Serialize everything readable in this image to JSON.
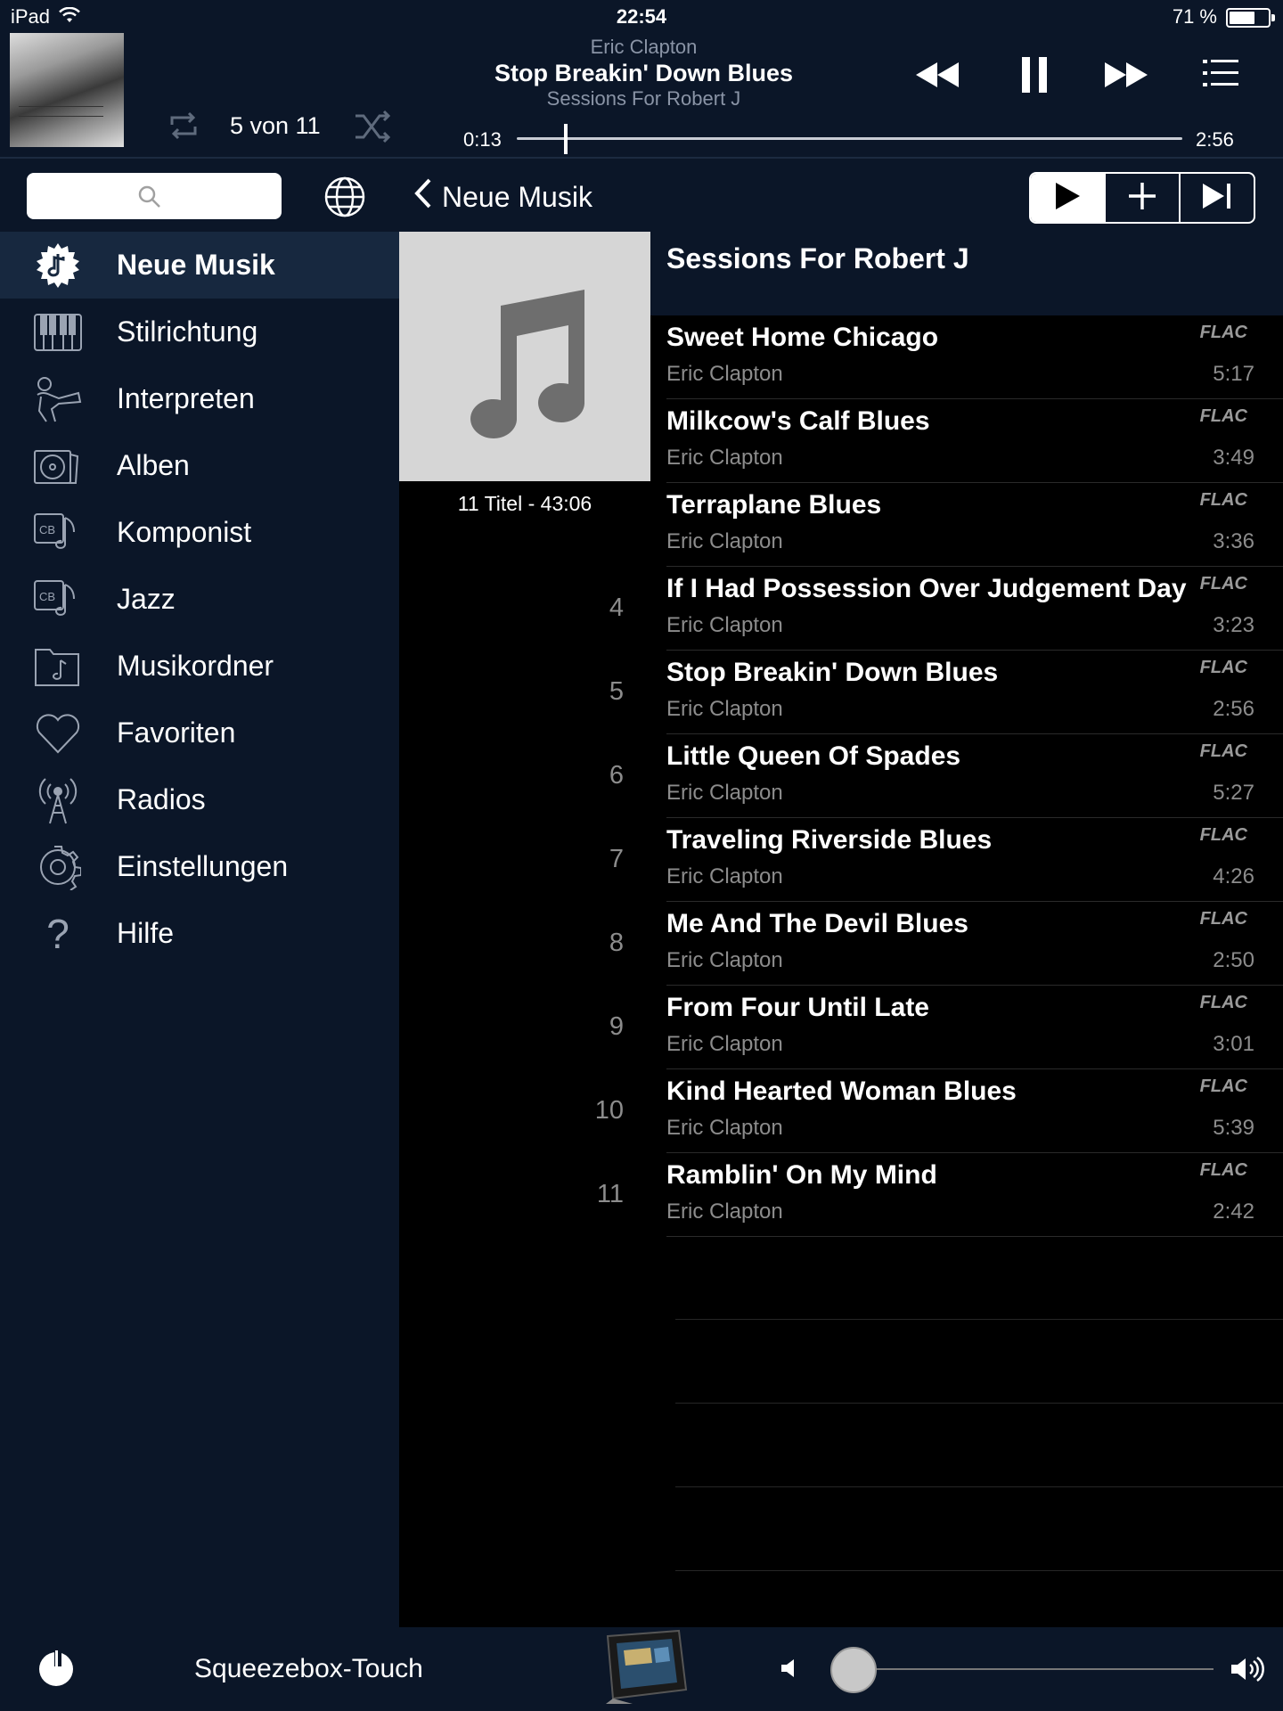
{
  "status_bar": {
    "device": "iPad",
    "time": "22:54",
    "battery": "71 %",
    "battery_level": 0.71
  },
  "now_playing": {
    "artist": "Eric Clapton",
    "title": "Stop Breakin' Down Blues",
    "album": "Sessions For Robert J",
    "position": "5 von 11",
    "elapsed": "0:13",
    "duration": "2:56",
    "progress": 0.074,
    "icons": [
      "repeat-icon",
      "shuffle-icon",
      "rewind-icon",
      "pause-icon",
      "fast-forward-icon",
      "queue-list-icon"
    ]
  },
  "nav": {
    "back_label": "Neue Musik",
    "actions": [
      "play-icon",
      "add-icon",
      "play-next-icon"
    ]
  },
  "sidebar": {
    "items": [
      {
        "label": "Neue Musik",
        "icon": "new-music-icon",
        "active": true
      },
      {
        "label": "Stilrichtung",
        "icon": "piano-icon"
      },
      {
        "label": "Interpreten",
        "icon": "musician-icon"
      },
      {
        "label": "Alben",
        "icon": "albums-icon"
      },
      {
        "label": "Komponist",
        "icon": "composer-icon"
      },
      {
        "label": "Jazz",
        "icon": "jazz-icon"
      },
      {
        "label": "Musikordner",
        "icon": "music-folder-icon"
      },
      {
        "label": "Favoriten",
        "icon": "heart-icon"
      },
      {
        "label": "Radios",
        "icon": "radio-icon"
      },
      {
        "label": "Einstellungen",
        "icon": "gear-icon"
      },
      {
        "label": "Hilfe",
        "icon": "help-icon"
      }
    ]
  },
  "album": {
    "title": "Sessions For Robert J",
    "summary": "11 Titel - 43:06",
    "tracks": [
      {
        "num": "",
        "title": "Sweet Home Chicago",
        "artist": "Eric Clapton",
        "format": "FLAC",
        "duration": "5:17"
      },
      {
        "num": "",
        "title": "Milkcow's Calf Blues",
        "artist": "Eric Clapton",
        "format": "FLAC",
        "duration": "3:49"
      },
      {
        "num": "",
        "title": "Terraplane Blues",
        "artist": "Eric Clapton",
        "format": "FLAC",
        "duration": "3:36"
      },
      {
        "num": "4",
        "title": "If I Had Possession Over Judgement Day",
        "artist": "Eric Clapton",
        "format": "FLAC",
        "duration": "3:23"
      },
      {
        "num": "5",
        "title": "Stop Breakin' Down Blues",
        "artist": "Eric Clapton",
        "format": "FLAC",
        "duration": "2:56"
      },
      {
        "num": "6",
        "title": "Little Queen Of Spades",
        "artist": "Eric Clapton",
        "format": "FLAC",
        "duration": "5:27"
      },
      {
        "num": "7",
        "title": "Traveling Riverside Blues",
        "artist": "Eric Clapton",
        "format": "FLAC",
        "duration": "4:26"
      },
      {
        "num": "8",
        "title": "Me And The Devil Blues",
        "artist": "Eric Clapton",
        "format": "FLAC",
        "duration": "2:50"
      },
      {
        "num": "9",
        "title": "From Four Until Late",
        "artist": "Eric Clapton",
        "format": "FLAC",
        "duration": "3:01"
      },
      {
        "num": "10",
        "title": "Kind Hearted Woman Blues",
        "artist": "Eric Clapton",
        "format": "FLAC",
        "duration": "5:39"
      },
      {
        "num": "11",
        "title": "Ramblin' On My Mind",
        "artist": "Eric Clapton",
        "format": "FLAC",
        "duration": "2:42"
      }
    ]
  },
  "footer": {
    "player_name": "Squeezebox-Touch",
    "volume": 0.02
  }
}
